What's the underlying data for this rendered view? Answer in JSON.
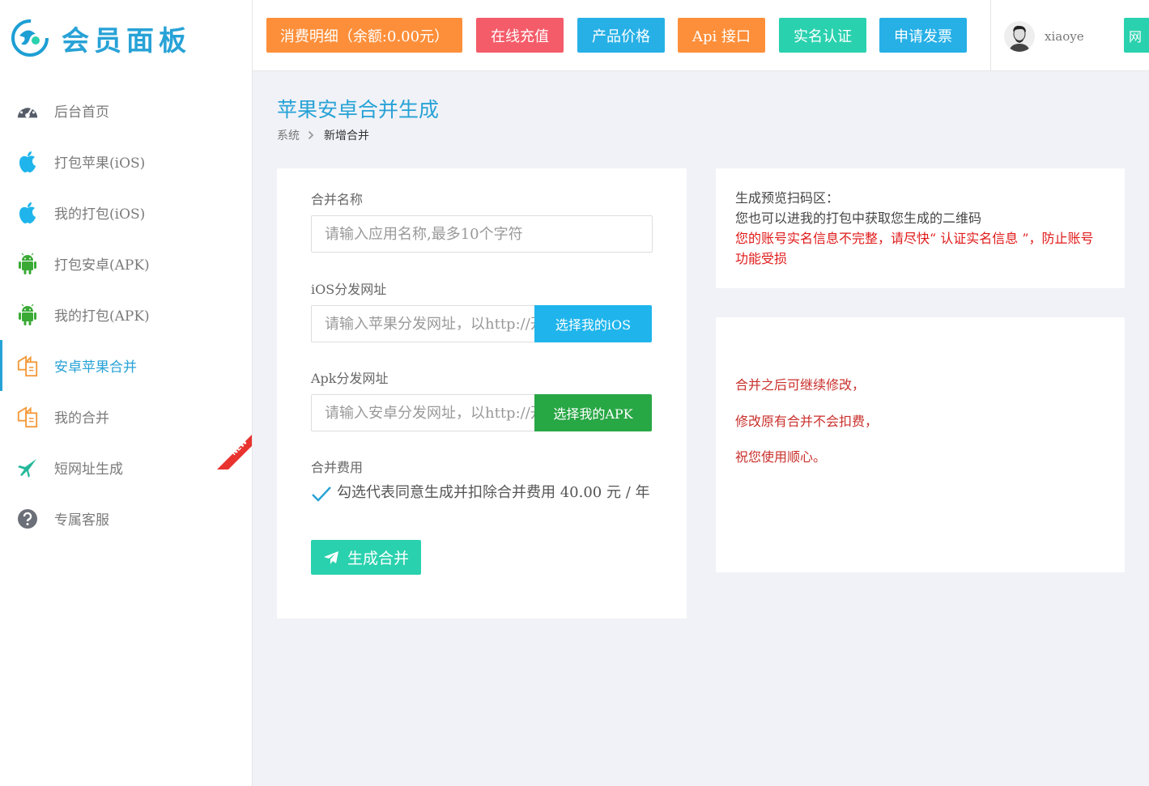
{
  "brand": {
    "title": "会员面板",
    "accent": "#27a2d6"
  },
  "sidebar": {
    "items": [
      {
        "label": "后台首页",
        "icon": "dashboard-icon",
        "active": false
      },
      {
        "label": "打包苹果(iOS)",
        "icon": "apple-icon",
        "active": false
      },
      {
        "label": "我的打包(iOS)",
        "icon": "apple-icon",
        "active": false
      },
      {
        "label": "打包安卓(APK)",
        "icon": "android-icon",
        "active": false
      },
      {
        "label": "我的打包(APK)",
        "icon": "android-icon",
        "active": false
      },
      {
        "label": "安卓苹果合并",
        "icon": "merge-icon",
        "active": true
      },
      {
        "label": "我的合并",
        "icon": "merge-icon",
        "active": false
      },
      {
        "label": "短网址生成",
        "icon": "plane-icon",
        "active": false,
        "badge": "NEW"
      },
      {
        "label": "专属客服",
        "icon": "question-icon",
        "active": false
      }
    ]
  },
  "topbar": {
    "buttons": [
      {
        "label": "消费明细（余额:0.00元）",
        "color": "#fd8f3a"
      },
      {
        "label": "在线充值",
        "color": "#f45c6a"
      },
      {
        "label": "产品价格",
        "color": "#27b0e6"
      },
      {
        "label": "Api 接口",
        "color": "#fd8f3a"
      },
      {
        "label": "实名认证",
        "color": "#2ad1ae"
      },
      {
        "label": "申请发票",
        "color": "#27b0e6"
      }
    ],
    "username": "xiaoye",
    "edge_label": "网"
  },
  "page": {
    "title": "苹果安卓合并生成",
    "breadcrumb": {
      "parent": "系统",
      "current": "新增合并"
    }
  },
  "form": {
    "name_label": "合并名称",
    "name_placeholder": "请输入应用名称,最多10个字符",
    "ios_label": "iOS分发网址",
    "ios_placeholder": "请输入苹果分发网址，以http://开头",
    "ios_button": "选择我的iOS",
    "apk_label": "Apk分发网址",
    "apk_placeholder": "请输入安卓分发网址，以http://开头",
    "apk_button": "选择我的APK",
    "fee_label": "合并费用",
    "agree_text": "勾选代表同意生成并扣除合并费用 40.00 元 / 年",
    "agree_checked": true,
    "submit_label": "生成合并",
    "ios_button_color": "#1fb5ec",
    "apk_button_color": "#28a745"
  },
  "qr": {
    "line1": "生成预览扫码区：",
    "line2": "您也可以进我的打包中获取您生成的二维码",
    "warning": "您的账号实名信息不完整，请尽快“ 认证实名信息 ”，防止账号功能受损"
  },
  "notes": {
    "line1": "合并之后可继续修改，",
    "line2": "修改原有合并不会扣费，",
    "line3": "祝您使用顺心。"
  }
}
